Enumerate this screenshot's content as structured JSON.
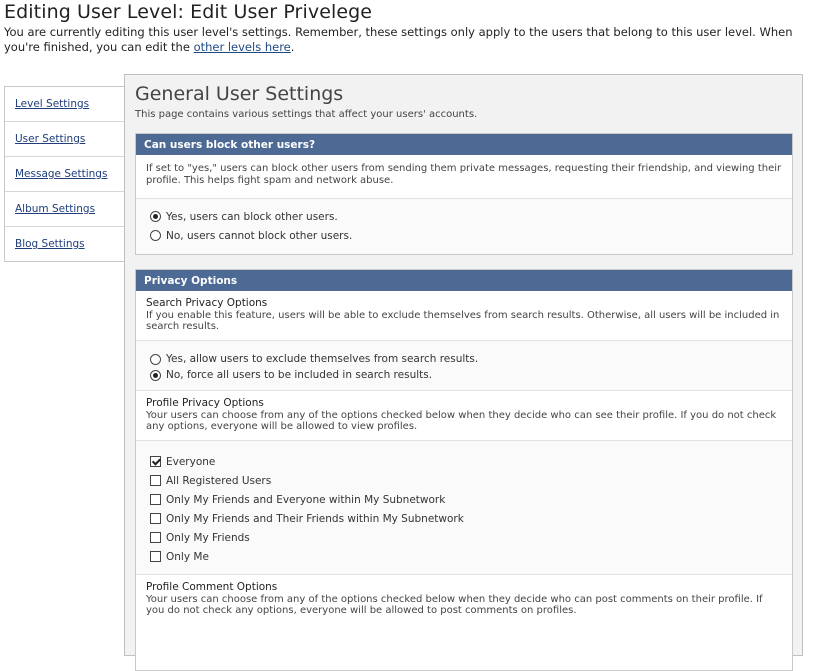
{
  "header": {
    "title": "Editing User Level: Edit User Privelege",
    "intro_text": "You are currently editing this user level's settings. Remember, these settings only apply to the users that belong to this user level. When you're finished, you can edit the ",
    "intro_link": "other levels here",
    "intro_end": "."
  },
  "sidebar": {
    "items": [
      {
        "label": "Level Settings"
      },
      {
        "label": "User Settings"
      },
      {
        "label": "Message Settings"
      },
      {
        "label": "Album Settings"
      },
      {
        "label": "Blog Settings"
      }
    ]
  },
  "main": {
    "title": "General User Settings",
    "description": "This page contains various settings that affect your users' accounts.",
    "block_users": {
      "header": "Can users block other users?",
      "description": "If set to \"yes,\" users can block other users from sending them private messages, requesting their friendship, and viewing their profile. This helps fight spam and network abuse.",
      "options": [
        {
          "label": "Yes, users can block other users.",
          "selected": true
        },
        {
          "label": "No, users cannot block other users.",
          "selected": false
        }
      ]
    },
    "privacy": {
      "header": "Privacy Options",
      "search": {
        "title": "Search Privacy Options",
        "description": "If you enable this feature, users will be able to exclude themselves from search results. Otherwise, all users will be included in search results.",
        "options": [
          {
            "label": "Yes, allow users to exclude themselves from search results.",
            "selected": false
          },
          {
            "label": "No, force all users to be included in search results.",
            "selected": true
          }
        ]
      },
      "profile": {
        "title": "Profile Privacy Options",
        "description": "Your users can choose from any of the options checked below when they decide who can see their profile. If you do not check any options, everyone will be allowed to view profiles.",
        "options": [
          {
            "label": "Everyone",
            "checked": true
          },
          {
            "label": "All Registered Users",
            "checked": false
          },
          {
            "label": "Only My Friends and Everyone within My Subnetwork",
            "checked": false
          },
          {
            "label": "Only My Friends and Their Friends within My Subnetwork",
            "checked": false
          },
          {
            "label": "Only My Friends",
            "checked": false
          },
          {
            "label": "Only Me",
            "checked": false
          }
        ]
      },
      "comment": {
        "title": "Profile Comment Options",
        "description": "Your users can choose from any of the options checked below when they decide who can post comments on their profile. If you do not check any options, everyone will be allowed to post comments on profiles."
      }
    }
  },
  "colors": {
    "header_bar": "#4d6a94",
    "link": "#1f3d7a"
  }
}
